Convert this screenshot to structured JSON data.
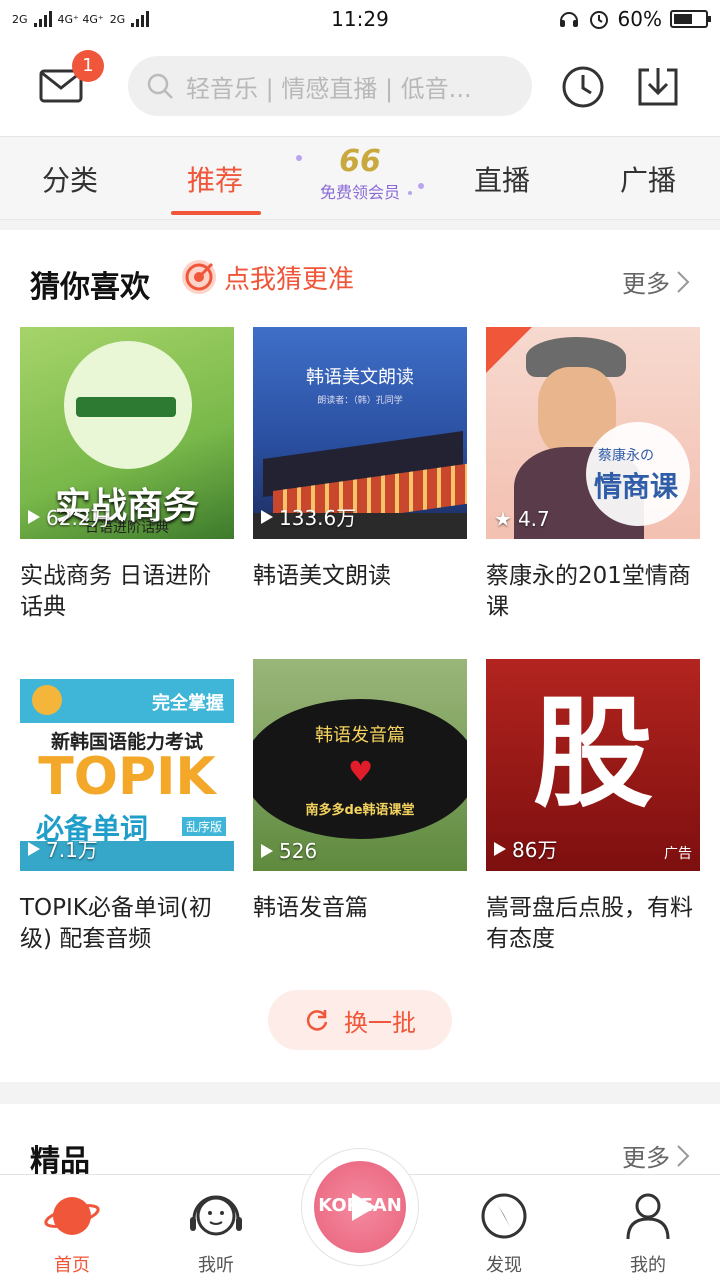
{
  "status_bar": {
    "network_1": "2G",
    "network_2": "4G⁺ 4G⁺",
    "network_3": "2G",
    "time": "11:29",
    "battery": "60%"
  },
  "header": {
    "mail_badge": "1",
    "search_placeholder": "轻音乐 | 情感直播 | 低音..."
  },
  "tabs": {
    "items": [
      "分类",
      "推荐",
      "直播",
      "广播"
    ],
    "active": "推荐",
    "vip_number": "66",
    "vip_label": "免费领会员"
  },
  "guess": {
    "title": "猜你喜欢",
    "hint": "点我猜更准",
    "more": "更多",
    "refresh": "换一批",
    "cards": [
      {
        "title": "实战商务 日语进阶话典",
        "stat": "62.2万",
        "stat_icon": "play",
        "cover_text": "实战商务",
        "cover_sub": "日语进阶话典"
      },
      {
        "title": "韩语美文朗读",
        "stat": "133.6万",
        "stat_icon": "play",
        "cover_text": "韩语美文朗读",
        "cover_sub": "朗读者：（韩）孔同学"
      },
      {
        "title": "蔡康永的201堂情商课",
        "stat": "4.7",
        "stat_icon": "star",
        "cover_text": "蔡康永の",
        "cover_sub": "情商课"
      },
      {
        "title": "TOPIK必备单词(初级) 配套音频",
        "stat": "7.1万",
        "stat_icon": "play",
        "cover_text": "新韩国语能力考试",
        "cover_sub": "TOPIK",
        "cover_sub2": "必备单词",
        "cover_top": "完全掌握",
        "cover_tag": "乱序版"
      },
      {
        "title": "韩语发音篇",
        "stat": "526",
        "stat_icon": "play",
        "cover_text": "韩语发音篇",
        "cover_sub": "南多多de韩语课堂"
      },
      {
        "title": "嵩哥盘后点股，有料有态度",
        "stat": "86万",
        "stat_icon": "play",
        "cover_text": "股",
        "ad_label": "广告"
      }
    ]
  },
  "boutique": {
    "title": "精品",
    "more": "更多"
  },
  "bottom_nav": {
    "items": [
      "首页",
      "我听",
      "发现",
      "我的"
    ],
    "player_label": "KOREAN"
  },
  "colors": {
    "accent": "#f0573a",
    "vip_purple": "#8a6bd6"
  }
}
